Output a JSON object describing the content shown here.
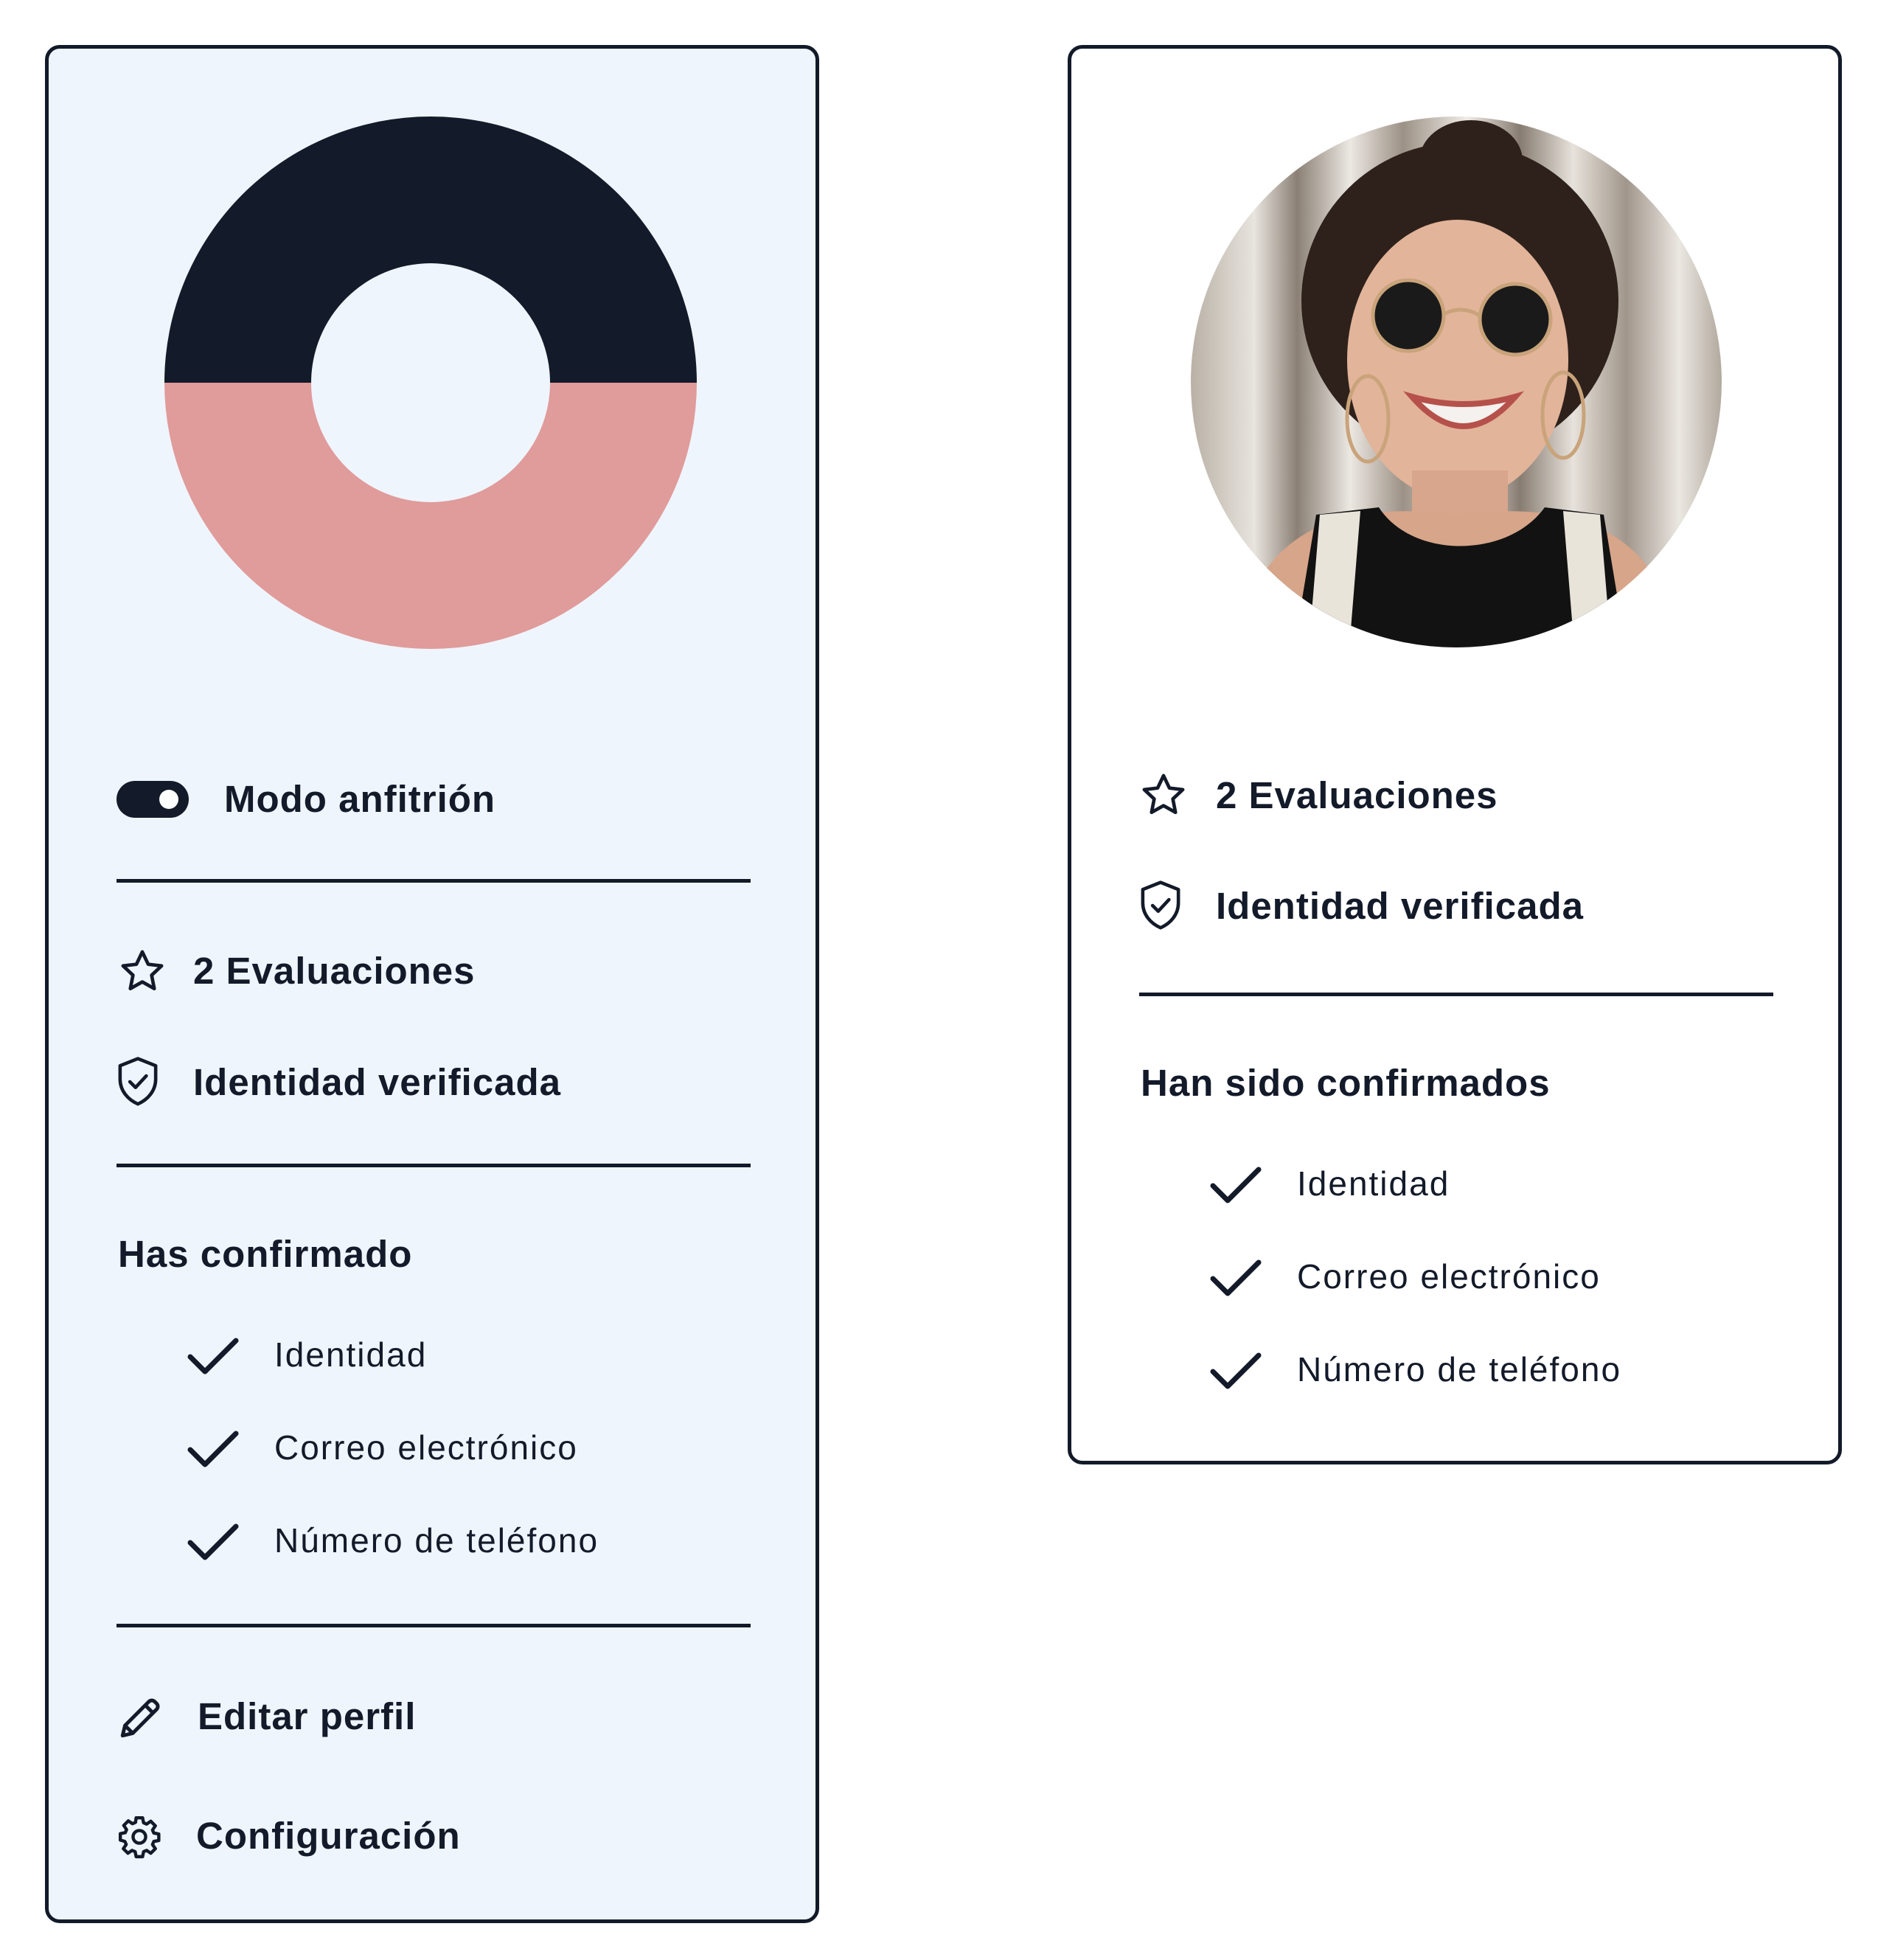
{
  "left_card": {
    "host_mode_label": "Modo anfitrión",
    "reviews_label": "2 Evaluaciones",
    "identity_label": "Identidad verificada",
    "confirmed_heading": "Has confirmado",
    "confirmed_items": [
      "Identidad",
      "Correo electrónico",
      "Número de teléfono"
    ],
    "edit_profile_label": "Editar perfil",
    "settings_label": "Configuración",
    "toggle_on": true
  },
  "right_card": {
    "reviews_label": "2 Evaluaciones",
    "identity_label": "Identidad verificada",
    "confirmed_heading": "Han sido confirmados",
    "confirmed_items": [
      "Identidad",
      "Correo electrónico",
      "Número de teléfono"
    ]
  },
  "colors": {
    "ink": "#131a29",
    "card_tint": "#eff5fd",
    "accent_pink": "#e09b9b"
  },
  "icons": {
    "toggle": "toggle-switch-icon",
    "star": "star-icon",
    "shield": "shield-check-icon",
    "check": "check-icon",
    "pencil": "pencil-icon",
    "gear": "gear-icon"
  }
}
